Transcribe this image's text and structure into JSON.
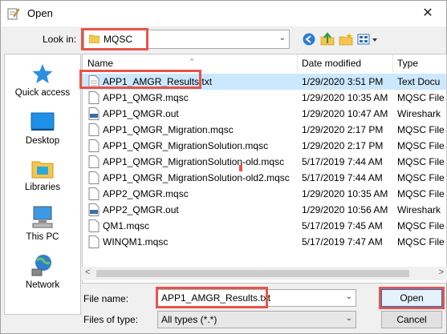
{
  "window": {
    "title": "Open",
    "close_glyph": "✕"
  },
  "toolbar": {
    "look_in_label": "Look in:",
    "look_in_value": "MQSC",
    "buttons": [
      "back-icon",
      "up-folder-icon",
      "new-folder-icon",
      "view-menu-icon"
    ]
  },
  "places": [
    {
      "label": "Quick access",
      "icon": "star-icon"
    },
    {
      "label": "Desktop",
      "icon": "desktop-icon"
    },
    {
      "label": "Libraries",
      "icon": "libraries-icon"
    },
    {
      "label": "This PC",
      "icon": "computer-icon"
    },
    {
      "label": "Network",
      "icon": "network-icon"
    }
  ],
  "columns": {
    "name": "Name",
    "date": "Date modified",
    "type": "Type"
  },
  "files": [
    {
      "name": "APP1_AMGR_Results.txt",
      "date": "1/29/2020 3:51 PM",
      "type": "Text Docu",
      "icon": "text-file-icon",
      "selected": true
    },
    {
      "name": "APP1_QMGR.mqsc",
      "date": "1/29/2020 10:35 AM",
      "type": "MQSC File",
      "icon": "file-icon"
    },
    {
      "name": "APP1_QMGR.out",
      "date": "1/29/2020 10:47 AM",
      "type": "Wireshark",
      "icon": "wireshark-file-icon"
    },
    {
      "name": "APP1_QMGR_Migration.mqsc",
      "date": "1/29/2020 2:17 PM",
      "type": "MQSC File",
      "icon": "file-icon"
    },
    {
      "name": "APP1_QMGR_MigrationSolution.mqsc",
      "date": "1/29/2020 2:17 PM",
      "type": "MQSC File",
      "icon": "file-icon"
    },
    {
      "name": "APP1_QMGR_MigrationSolution-old.mqsc",
      "date": "5/17/2019 7:44 AM",
      "type": "MQSC File",
      "icon": "file-icon"
    },
    {
      "name": "APP1_QMGR_MigrationSolution-old2.mqsc",
      "date": "5/17/2019 7:44 AM",
      "type": "MQSC File",
      "icon": "file-icon"
    },
    {
      "name": "APP2_QMGR.mqsc",
      "date": "1/29/2020 10:35 AM",
      "type": "MQSC File",
      "icon": "file-icon"
    },
    {
      "name": "APP2_QMGR.out",
      "date": "1/29/2020 10:56 AM",
      "type": "Wireshark",
      "icon": "wireshark-file-icon"
    },
    {
      "name": "QM1.mqsc",
      "date": "5/17/2019 7:45 AM",
      "type": "MQSC File",
      "icon": "file-icon"
    },
    {
      "name": "WINQM1.mqsc",
      "date": "5/17/2019 7:47 AM",
      "type": "MQSC File",
      "icon": "file-icon"
    }
  ],
  "scroll": {
    "left_glyph": "<",
    "right_glyph": ">"
  },
  "bottom": {
    "file_name_label": "File name:",
    "file_name_value": "APP1_AMGR_Results.txt",
    "file_type_label": "Files of type:",
    "file_type_value": "All types (*.*)",
    "open_label": "Open",
    "cancel_label": "Cancel"
  },
  "colors": {
    "highlight": "#e8544a",
    "selection": "#cce8ff",
    "folder": "#f5c64f"
  }
}
